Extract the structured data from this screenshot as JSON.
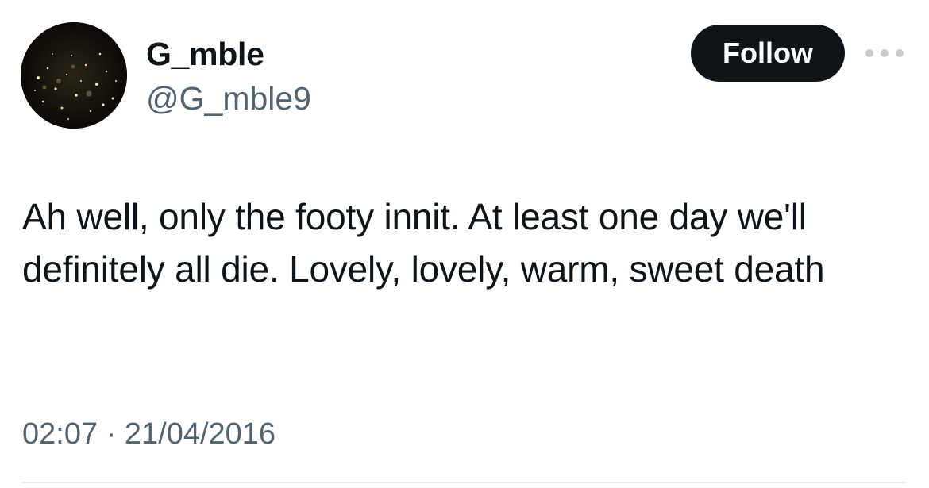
{
  "author": {
    "display_name": "G_mble",
    "handle": "@G_mble9",
    "avatar_icon": "starry-night-avatar"
  },
  "actions": {
    "follow_label": "Follow",
    "more_icon": "more-options-icon"
  },
  "tweet": {
    "text": "Ah well, only the footy innit. At least one day we'll definitely all die. Lovely, lovely, warm, sweet death",
    "time": "02:07",
    "separator": "·",
    "date": "21/04/2016"
  },
  "colors": {
    "text_primary": "#0f1419",
    "text_secondary": "#536471",
    "button_bg": "#0f1419",
    "button_text": "#ffffff",
    "divider": "#e6ebee"
  }
}
